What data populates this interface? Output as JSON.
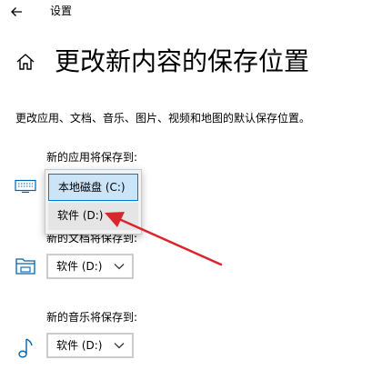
{
  "window": {
    "title": "设置"
  },
  "page": {
    "title": "更改新内容的保存位置",
    "description": "更改应用、文档、音乐、图片、视频和地图的默认保存位置。"
  },
  "sections": {
    "apps": {
      "label": "新的应用将保存到:",
      "icon": "monitor-icon"
    },
    "documents": {
      "label": "新的文档将保存到:",
      "icon": "folder-icon",
      "selected": "软件 (D:)"
    },
    "music": {
      "label": "新的音乐将保存到:",
      "icon": "music-note-icon",
      "selected": "软件 (D:)"
    }
  },
  "apps_dropdown_open": {
    "options": [
      "本地磁盘 (C:)",
      "软件 (D:)"
    ],
    "highlighted_option": "本地磁盘 (C:)",
    "hovered_option": "软件 (D:)"
  },
  "colors": {
    "accent": "#0078d7",
    "selected_bg": "#cce4f7",
    "annotation_arrow": "#d9262c",
    "dropdown_border": "#cccccc"
  }
}
